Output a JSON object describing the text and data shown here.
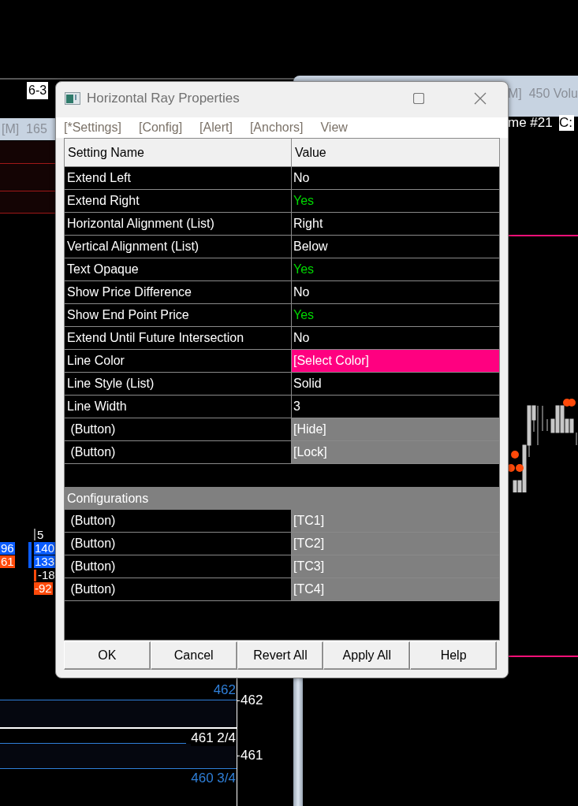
{
  "left_chart": {
    "title": "[M]  165",
    "tag": "6-3",
    "cells": [
      {
        "text": "5",
        "kind": "plain"
      },
      {
        "text": "96",
        "kind": "bid"
      },
      {
        "text": "140",
        "kind": "bid"
      },
      {
        "text": "61",
        "kind": "ask"
      },
      {
        "text": "133",
        "kind": "bid"
      },
      {
        "text": "-18",
        "kind": "plain"
      },
      {
        "text": "-92",
        "kind": "ask"
      }
    ],
    "price_labels": [
      {
        "text": "462",
        "kind": "line"
      },
      {
        "text": "461 2/4",
        "kind": "last"
      },
      {
        "text": "460 3/4",
        "kind": "line"
      }
    ],
    "scale": [
      "462",
      "461"
    ]
  },
  "right_chart": {
    "title": "M]  450 Volu",
    "info": "me #21",
    "price_tag": "C:"
  },
  "dialog": {
    "title": "Horizontal Ray Properties",
    "menu": [
      "[*Settings]",
      "[Config]",
      "[Alert]",
      "[Anchors]",
      "View"
    ],
    "columns": [
      "Setting Name",
      "Value"
    ],
    "settings": [
      {
        "name": "Extend Left",
        "value": "No",
        "kind": "boolean",
        "on": false
      },
      {
        "name": "Extend Right",
        "value": "Yes",
        "kind": "boolean",
        "on": true
      },
      {
        "name": "Horizontal Alignment (List)",
        "value": "Right",
        "kind": "text"
      },
      {
        "name": "Vertical Alignment (List)",
        "value": "Below",
        "kind": "text"
      },
      {
        "name": "Text Opaque",
        "value": "Yes",
        "kind": "boolean",
        "on": true
      },
      {
        "name": "Show Price Difference",
        "value": "No",
        "kind": "boolean",
        "on": false
      },
      {
        "name": "Show End Point Price",
        "value": "Yes",
        "kind": "boolean",
        "on": true
      },
      {
        "name": "Extend Until Future Intersection",
        "value": "No",
        "kind": "boolean",
        "on": false
      },
      {
        "name": "Line Color",
        "value": "[Select Color]",
        "kind": "color",
        "color": "#ff0080"
      },
      {
        "name": "Line Style (List)",
        "value": "Solid",
        "kind": "text"
      },
      {
        "name": "Line Width",
        "value": "3",
        "kind": "text"
      },
      {
        "name": " (Button)",
        "value": "[Hide]",
        "kind": "button"
      },
      {
        "name": " (Button)",
        "value": "[Lock]",
        "kind": "button"
      }
    ],
    "section": {
      "title": "Configurations",
      "rows": [
        {
          "name": " (Button)",
          "value": "[TC1]",
          "kind": "button"
        },
        {
          "name": " (Button)",
          "value": "[TC2]",
          "kind": "button"
        },
        {
          "name": " (Button)",
          "value": "[TC3]",
          "kind": "button"
        },
        {
          "name": " (Button)",
          "value": "[TC4]",
          "kind": "button"
        }
      ]
    },
    "buttons": [
      "OK",
      "Cancel",
      "Revert All",
      "Apply All",
      "Help"
    ]
  }
}
